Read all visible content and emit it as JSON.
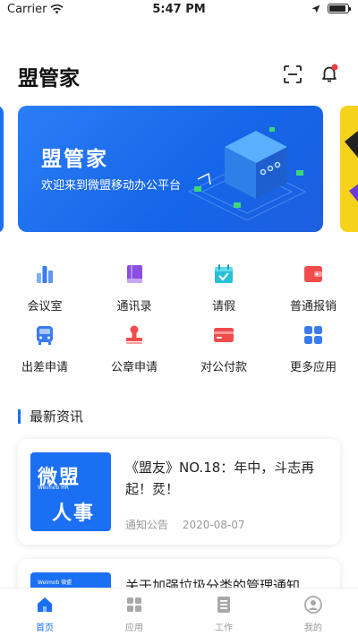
{
  "status_bar": {
    "carrier": "Carrier",
    "time": "5:47 PM"
  },
  "header": {
    "title": "盟管家"
  },
  "banner": {
    "title": "盟管家",
    "subtitle": "欢迎来到微盟移动办公平台"
  },
  "grid": [
    {
      "label": "会议室",
      "icon": "meeting-room-icon",
      "color": "#3a7bf0"
    },
    {
      "label": "通讯录",
      "icon": "contacts-icon",
      "color": "#8a4ee0"
    },
    {
      "label": "请假",
      "icon": "leave-calendar-icon",
      "color": "#27c0d8"
    },
    {
      "label": "普通报销",
      "icon": "wallet-icon",
      "color": "#f04c4c"
    },
    {
      "label": "出差申请",
      "icon": "bus-icon",
      "color": "#3a7bf0"
    },
    {
      "label": "公章申请",
      "icon": "stamp-icon",
      "color": "#f04c4c"
    },
    {
      "label": "对公付款",
      "icon": "card-icon",
      "color": "#f04c4c"
    },
    {
      "label": "更多应用",
      "icon": "more-apps-icon",
      "color": "#3a7bf0"
    }
  ],
  "news": {
    "section_title": "最新资讯",
    "items": [
      {
        "title": "《盟友》NO.18：年中，斗志再起！烎！",
        "category": "通知公告",
        "date": "2020-08-07",
        "thumb_line1": "微盟",
        "thumb_line2": "Weimob HR",
        "thumb_line3": "人事"
      },
      {
        "title": "关于加强垃圾分类的管理通知",
        "thumb_line1": "Weimob 微盟"
      }
    ]
  },
  "tabbar": [
    {
      "label": "首页",
      "icon": "home-icon",
      "active": true
    },
    {
      "label": "应用",
      "icon": "apps-icon",
      "active": false
    },
    {
      "label": "工作",
      "icon": "work-icon",
      "active": false
    },
    {
      "label": "我的",
      "icon": "profile-icon",
      "active": false
    }
  ],
  "colors": {
    "accent": "#1a6ff3",
    "badge": "#f03c3c"
  }
}
